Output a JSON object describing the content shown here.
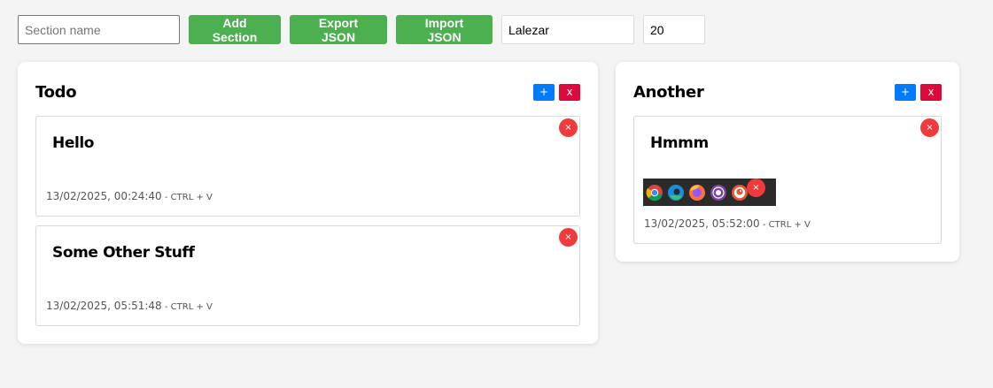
{
  "toolbar": {
    "section_placeholder": "Section name",
    "add_label": "Add Section",
    "export_label": "Export JSON",
    "import_label": "Import JSON",
    "font_value": "Lalezar",
    "size_value": "20"
  },
  "colors": {
    "green": "#4caf50",
    "blue": "#007bff",
    "red": "#dc0a3c",
    "close_red": "#ef3b3b"
  },
  "sections": [
    {
      "title": "Todo",
      "add_label": "+",
      "delete_label": "x",
      "cards": [
        {
          "title": "Hello",
          "timestamp": "13/02/2025, 00:24:40",
          "source": " - CTRL + V",
          "close": "×"
        },
        {
          "title": "Some Other Stuff",
          "timestamp": "13/02/2025, 05:51:48",
          "source": " - CTRL + V",
          "close": "×"
        }
      ]
    },
    {
      "title": "Another",
      "add_label": "+",
      "delete_label": "x",
      "cards": [
        {
          "title": "Hmmm",
          "timestamp": "13/02/2025, 05:52:00",
          "source": " - CTRL + V",
          "close": "×",
          "image_close": "×",
          "image_icons": [
            "chrome-icon",
            "edge-icon",
            "firefox-icon",
            "tor-icon",
            "duckduckgo-icon"
          ]
        }
      ]
    }
  ]
}
